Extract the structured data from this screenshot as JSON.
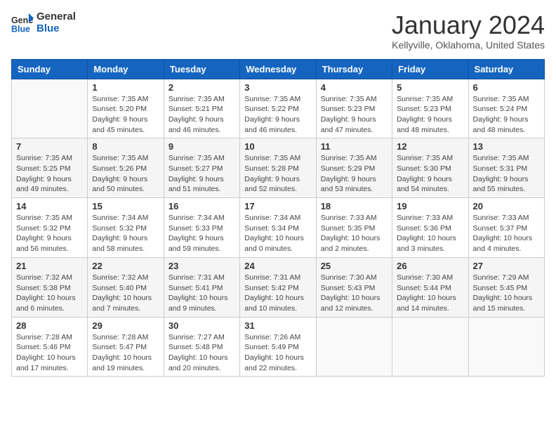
{
  "header": {
    "logo_line1": "General",
    "logo_line2": "Blue",
    "month": "January 2024",
    "location": "Kellyville, Oklahoma, United States"
  },
  "days_of_week": [
    "Sunday",
    "Monday",
    "Tuesday",
    "Wednesday",
    "Thursday",
    "Friday",
    "Saturday"
  ],
  "weeks": [
    [
      {
        "day": "",
        "info": ""
      },
      {
        "day": "1",
        "info": "Sunrise: 7:35 AM\nSunset: 5:20 PM\nDaylight: 9 hours\nand 45 minutes."
      },
      {
        "day": "2",
        "info": "Sunrise: 7:35 AM\nSunset: 5:21 PM\nDaylight: 9 hours\nand 46 minutes."
      },
      {
        "day": "3",
        "info": "Sunrise: 7:35 AM\nSunset: 5:22 PM\nDaylight: 9 hours\nand 46 minutes."
      },
      {
        "day": "4",
        "info": "Sunrise: 7:35 AM\nSunset: 5:23 PM\nDaylight: 9 hours\nand 47 minutes."
      },
      {
        "day": "5",
        "info": "Sunrise: 7:35 AM\nSunset: 5:23 PM\nDaylight: 9 hours\nand 48 minutes."
      },
      {
        "day": "6",
        "info": "Sunrise: 7:35 AM\nSunset: 5:24 PM\nDaylight: 9 hours\nand 48 minutes."
      }
    ],
    [
      {
        "day": "7",
        "info": "Sunrise: 7:35 AM\nSunset: 5:25 PM\nDaylight: 9 hours\nand 49 minutes."
      },
      {
        "day": "8",
        "info": "Sunrise: 7:35 AM\nSunset: 5:26 PM\nDaylight: 9 hours\nand 50 minutes."
      },
      {
        "day": "9",
        "info": "Sunrise: 7:35 AM\nSunset: 5:27 PM\nDaylight: 9 hours\nand 51 minutes."
      },
      {
        "day": "10",
        "info": "Sunrise: 7:35 AM\nSunset: 5:28 PM\nDaylight: 9 hours\nand 52 minutes."
      },
      {
        "day": "11",
        "info": "Sunrise: 7:35 AM\nSunset: 5:29 PM\nDaylight: 9 hours\nand 53 minutes."
      },
      {
        "day": "12",
        "info": "Sunrise: 7:35 AM\nSunset: 5:30 PM\nDaylight: 9 hours\nand 54 minutes."
      },
      {
        "day": "13",
        "info": "Sunrise: 7:35 AM\nSunset: 5:31 PM\nDaylight: 9 hours\nand 55 minutes."
      }
    ],
    [
      {
        "day": "14",
        "info": "Sunrise: 7:35 AM\nSunset: 5:32 PM\nDaylight: 9 hours\nand 56 minutes."
      },
      {
        "day": "15",
        "info": "Sunrise: 7:34 AM\nSunset: 5:32 PM\nDaylight: 9 hours\nand 58 minutes."
      },
      {
        "day": "16",
        "info": "Sunrise: 7:34 AM\nSunset: 5:33 PM\nDaylight: 9 hours\nand 59 minutes."
      },
      {
        "day": "17",
        "info": "Sunrise: 7:34 AM\nSunset: 5:34 PM\nDaylight: 10 hours\nand 0 minutes."
      },
      {
        "day": "18",
        "info": "Sunrise: 7:33 AM\nSunset: 5:35 PM\nDaylight: 10 hours\nand 2 minutes."
      },
      {
        "day": "19",
        "info": "Sunrise: 7:33 AM\nSunset: 5:36 PM\nDaylight: 10 hours\nand 3 minutes."
      },
      {
        "day": "20",
        "info": "Sunrise: 7:33 AM\nSunset: 5:37 PM\nDaylight: 10 hours\nand 4 minutes."
      }
    ],
    [
      {
        "day": "21",
        "info": "Sunrise: 7:32 AM\nSunset: 5:38 PM\nDaylight: 10 hours\nand 6 minutes."
      },
      {
        "day": "22",
        "info": "Sunrise: 7:32 AM\nSunset: 5:40 PM\nDaylight: 10 hours\nand 7 minutes."
      },
      {
        "day": "23",
        "info": "Sunrise: 7:31 AM\nSunset: 5:41 PM\nDaylight: 10 hours\nand 9 minutes."
      },
      {
        "day": "24",
        "info": "Sunrise: 7:31 AM\nSunset: 5:42 PM\nDaylight: 10 hours\nand 10 minutes."
      },
      {
        "day": "25",
        "info": "Sunrise: 7:30 AM\nSunset: 5:43 PM\nDaylight: 10 hours\nand 12 minutes."
      },
      {
        "day": "26",
        "info": "Sunrise: 7:30 AM\nSunset: 5:44 PM\nDaylight: 10 hours\nand 14 minutes."
      },
      {
        "day": "27",
        "info": "Sunrise: 7:29 AM\nSunset: 5:45 PM\nDaylight: 10 hours\nand 15 minutes."
      }
    ],
    [
      {
        "day": "28",
        "info": "Sunrise: 7:28 AM\nSunset: 5:46 PM\nDaylight: 10 hours\nand 17 minutes."
      },
      {
        "day": "29",
        "info": "Sunrise: 7:28 AM\nSunset: 5:47 PM\nDaylight: 10 hours\nand 19 minutes."
      },
      {
        "day": "30",
        "info": "Sunrise: 7:27 AM\nSunset: 5:48 PM\nDaylight: 10 hours\nand 20 minutes."
      },
      {
        "day": "31",
        "info": "Sunrise: 7:26 AM\nSunset: 5:49 PM\nDaylight: 10 hours\nand 22 minutes."
      },
      {
        "day": "",
        "info": ""
      },
      {
        "day": "",
        "info": ""
      },
      {
        "day": "",
        "info": ""
      }
    ]
  ]
}
